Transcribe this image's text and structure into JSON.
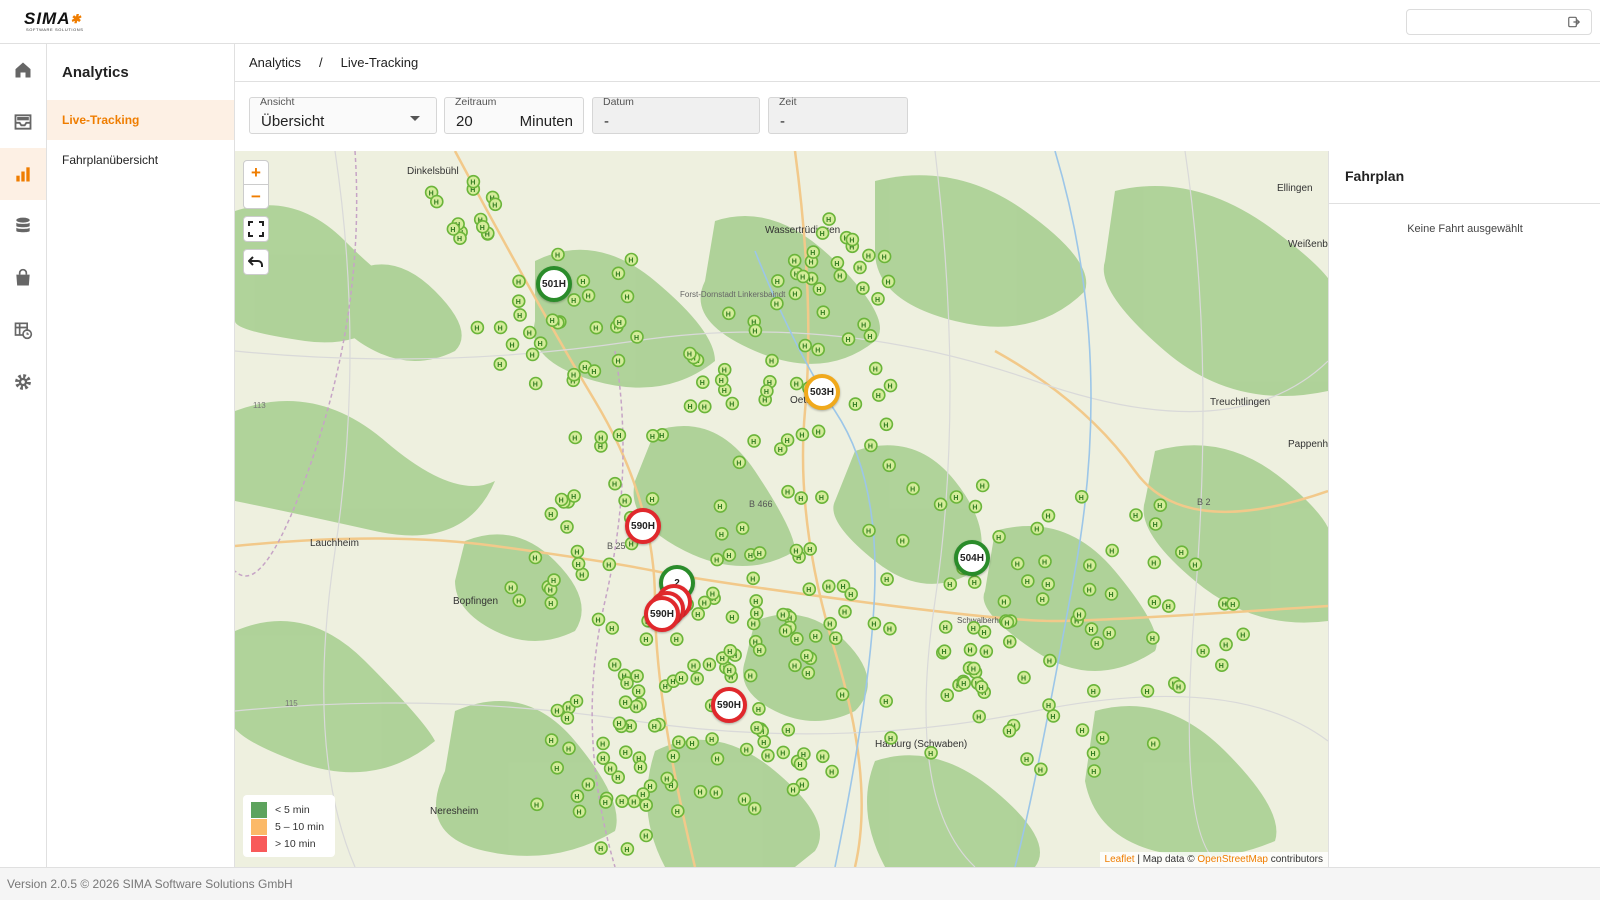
{
  "app": {
    "brand": "SIMA",
    "tagline": "SOFTWARE SOLUTIONS"
  },
  "header": {
    "logout_icon": "logout-icon"
  },
  "rail": [
    {
      "icon": "home-icon"
    },
    {
      "icon": "inbox-icon"
    },
    {
      "icon": "analytics-icon",
      "active": true
    },
    {
      "icon": "database-icon"
    },
    {
      "icon": "shopping-bag-icon"
    },
    {
      "icon": "table-clock-icon"
    },
    {
      "icon": "gear-icon"
    }
  ],
  "subnav": {
    "title": "Analytics",
    "items": [
      {
        "label": "Live-Tracking",
        "active": true
      },
      {
        "label": "Fahrplanübersicht",
        "active": false
      }
    ]
  },
  "breadcrumb": {
    "root": "Analytics",
    "separator": "/",
    "current": "Live-Tracking"
  },
  "filters": {
    "view": {
      "label": "Ansicht",
      "value": "Übersicht"
    },
    "period": {
      "label": "Zeitraum",
      "value": "20",
      "unit": "Minuten"
    },
    "date": {
      "label": "Datum",
      "value": "-"
    },
    "time": {
      "label": "Zeit",
      "value": "-"
    }
  },
  "map": {
    "zoom_in": "+",
    "zoom_out": "−",
    "places": [
      "Dinkelsbühl",
      "Wassertrüdingen",
      "Forst-Dornstadt Linkersbaindt",
      "Oettingen",
      "Treuchtlingen",
      "Lauchheim",
      "Bopfingen",
      "Harburg (Schwaben)",
      "Neresheim",
      "Schwalberholz",
      "Ellingen",
      "Weißenburg in Bayern",
      "Pappenheim"
    ],
    "road_labels": [
      "B 25",
      "B 2",
      "B 466",
      "113",
      "115"
    ],
    "markers": [
      {
        "label": "501H",
        "status": "green"
      },
      {
        "label": "503H",
        "status": "orange"
      },
      {
        "label": "590H",
        "status": "red"
      },
      {
        "label": "504H",
        "status": "green"
      },
      {
        "label": "2",
        "status": "green"
      },
      {
        "label": "590H",
        "status": "red"
      },
      {
        "label": "590H",
        "status": "red"
      }
    ],
    "legend": [
      {
        "label": "< 5 min",
        "color": "#4caf50"
      },
      {
        "label": "5 – 10 min",
        "color": "#ffb74d"
      },
      {
        "label": "> 10 min",
        "color": "#ff5252"
      }
    ],
    "attribution": {
      "leaflet": "Leaflet",
      "mid": " | Map data © ",
      "osm": "OpenStreetMap",
      "tail": " contributors"
    }
  },
  "panel": {
    "title": "Fahrplan",
    "empty": "Keine Fahrt ausgewählt"
  },
  "footer": {
    "text": "Version 2.0.5 © 2026 SIMA Software Solutions GmbH"
  },
  "colors": {
    "accent": "#ef7d00",
    "active_bg": "#fdf0e4",
    "stop_green": "#6bb53a",
    "forest": "#a9cf93"
  }
}
